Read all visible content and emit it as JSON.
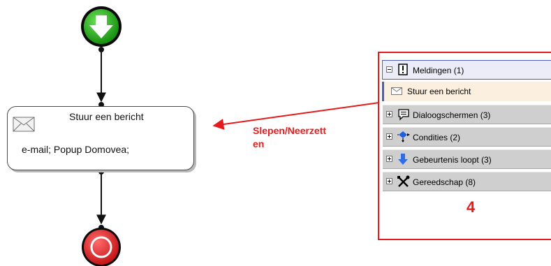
{
  "flow": {
    "action": {
      "title": "Stuur een bericht",
      "detail": "e-mail; Popup Domovea;"
    },
    "colors": {
      "start": "#16a30f",
      "end": "#e8171c",
      "connector": "#111111"
    }
  },
  "drag_hint": {
    "line1": "Slepen/Neerzett",
    "line2": "en",
    "color": "#e02020"
  },
  "toolbox": {
    "groups": [
      {
        "label": "Meldingen (1)",
        "icon": "notification-icon",
        "expanded": true
      },
      {
        "label": "Dialoogschermen (3)",
        "icon": "dialog-icon",
        "expanded": false
      },
      {
        "label": "Condities (2)",
        "icon": "condition-icon",
        "expanded": false
      },
      {
        "label": "Gebeurtenis loopt (3)",
        "icon": "event-arrow-icon",
        "expanded": false
      },
      {
        "label": "Gereedschap (8)",
        "icon": "tools-icon",
        "expanded": false
      }
    ],
    "items": [
      {
        "label": "Stuur een bericht",
        "icon": "mail-icon"
      }
    ]
  },
  "step_number": "4"
}
